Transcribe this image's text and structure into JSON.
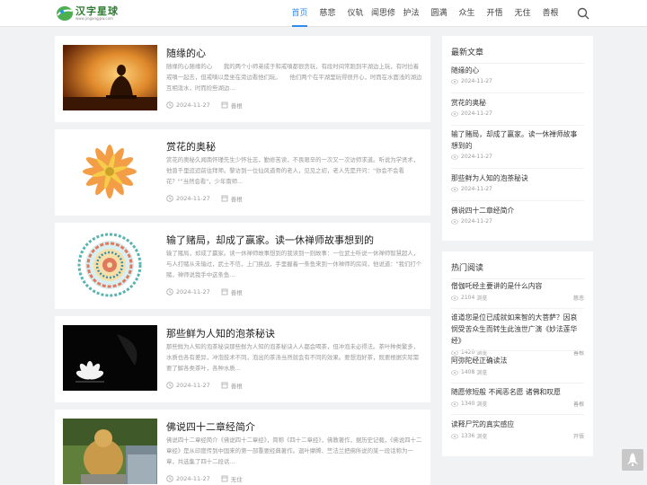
{
  "site": {
    "logo_text": "汉字星球",
    "logo_url": "www.jingangjpw.com"
  },
  "nav": {
    "items": [
      "首页",
      "慈悲",
      "仪轨",
      "闻思修",
      "护法",
      "圆满",
      "众生",
      "开悟",
      "无住",
      "善根"
    ]
  },
  "posts": [
    {
      "title": "随缘的心",
      "excerpt": "随缘的心随缘的心　　我的两个小师弟成于和戒嗔都很贪玩，有段时间常跑到平湖边上玩，有时拉着戒嗔一起去，但戒嗔以是坐在旁边看他们玩。　　他们两个在平湖里玩得很开心，时而在水面浅的湖边互相泼水，时而捡些湖边...",
      "date": "2024-11-27",
      "category": "善根"
    },
    {
      "title": "赏花的奥秘",
      "excerpt": "赏花的奥秘久闻南怀瑾先生少怀壮志，勤修苦读，不畏艰辛的一次又一次访师求道。听说为学贤术，他曾千里迢迢前往拜师。黎访到一位仙风道骨的老人，见见之初，老人先是开问：\"你会不会看花？\"\"当然会看\"，少年南师...",
      "date": "2024-11-27",
      "category": "善根"
    },
    {
      "title": "输了赌局，却成了赢家。读一休禅师故事想到的",
      "excerpt": "输了赌局，却成了赢家。读一休禅师故事想到的我读到一则故事：一位武士听说一休禅师智慧超人，与人打赌从未输过，武士不信，上门挑战，手里握着一条鱼来到一休禅师的房间，他说道：\"我们打个赌，禅师说我手中这条鱼...",
      "date": "2024-11-27",
      "category": "善根"
    },
    {
      "title": "那些鲜为人知的泡茶秘诀",
      "excerpt": "那些鲜为人知的泡茶秘诀那些鲜为人知的泡茶秘诀人人都会喝茶，但冲泡未必得法。茶叶种类繁多，水质也各有差异，冲泡技术不同，泡出的茶汤当然就会有不同的效果。要想泡好茶，既要根据实际需要了解各类茶叶，各种水质...",
      "date": "2024-11-27",
      "category": "善根"
    },
    {
      "title": "佛说四十二章经简介",
      "excerpt": "佛说四十二章经简介《佛说四十二章经》，简称《四十二章经》，佛教著作，据历史记载，《佛说四十二章经》是从印度传到中国来的第一部重要经典著作。迦叶摩腾、竺法兰把佛所说的某一段话称为一章，共选集了四十二段话...",
      "date": "2024-11-27",
      "category": "无住"
    }
  ],
  "latest": {
    "title": "最新文章",
    "items": [
      {
        "title": "随缘的心",
        "date": "2024-11-27"
      },
      {
        "title": "赏花的奥秘",
        "date": "2024-11-27"
      },
      {
        "title": "输了赌局，却成了赢家。读一休禅师故事想到的",
        "date": "2024-11-27"
      },
      {
        "title": "那些鲜为人知的泡茶秘诀",
        "date": "2024-11-27"
      },
      {
        "title": "佛说四十二章经简介",
        "date": "2024-11-27"
      }
    ]
  },
  "hot": {
    "title": "热门阅读",
    "items": [
      {
        "title": "僧伽吒经主要讲的是什么内容",
        "views": "2104",
        "category": "慈悲"
      },
      {
        "title": "谁道您是位已成就如来智的大菩萨？因哀悯受苦众生而转生此浊世广演《妙法莲华经》",
        "views": "1420",
        "category": "善根"
      },
      {
        "title": "阿弥陀经正确读法",
        "views": "1408",
        "category": ""
      },
      {
        "title": "随愿修短般 不闻恶名愿 诸佛和叹愿",
        "views": "1340",
        "category": "善根"
      },
      {
        "title": "读释尸咒的真实感应",
        "views": "1336",
        "category": "开悟"
      }
    ],
    "views_suffix": "浏览"
  }
}
